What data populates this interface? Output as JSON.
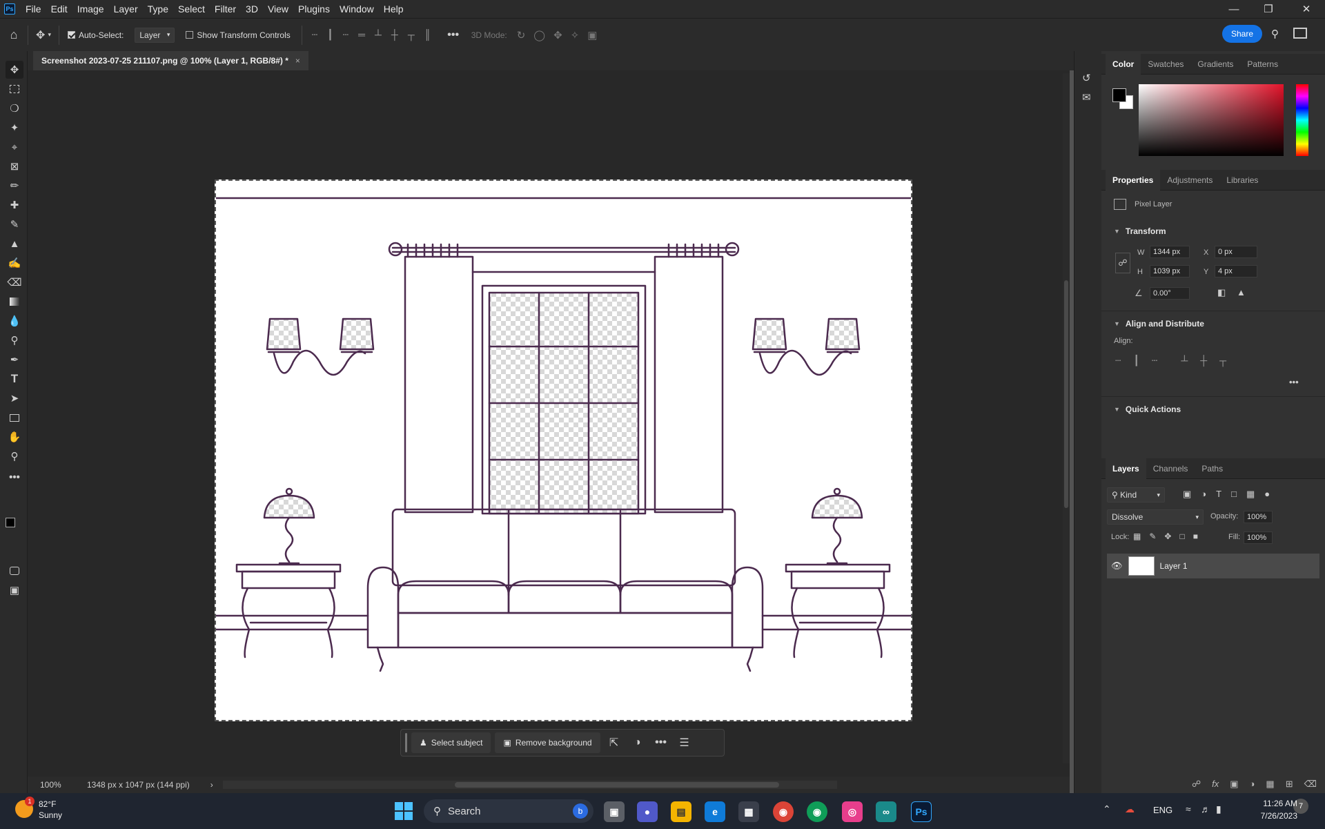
{
  "menubar": {
    "items": [
      "File",
      "Edit",
      "Image",
      "Layer",
      "Type",
      "Select",
      "Filter",
      "3D",
      "View",
      "Plugins",
      "Window",
      "Help"
    ],
    "logo": "Ps"
  },
  "options": {
    "auto_select_label": "Auto-Select:",
    "auto_select_value": "Layer",
    "show_transform_label": "Show Transform Controls",
    "mode_3d_label": "3D Mode:",
    "share_label": "Share"
  },
  "document": {
    "tab_title": "Screenshot 2023-07-25 211107.png @ 100% (Layer 1, RGB/8#) *",
    "close_glyph": "×"
  },
  "status": {
    "zoom": "100%",
    "dimensions": "1348 px x 1047 px (144 ppi)"
  },
  "context_bar": {
    "select_subject": "Select subject",
    "remove_background": "Remove background"
  },
  "color_panel": {
    "tabs": [
      "Color",
      "Swatches",
      "Gradients",
      "Patterns"
    ],
    "fg": "#000000",
    "bg": "#ffffff"
  },
  "properties_panel": {
    "tabs": [
      "Properties",
      "Adjustments",
      "Libraries"
    ],
    "layer_type": "Pixel Layer",
    "transform_title": "Transform",
    "w_label": "W",
    "w_value": "1344 px",
    "h_label": "H",
    "h_value": "1039 px",
    "x_label": "X",
    "x_value": "0 px",
    "y_label": "Y",
    "y_value": "4 px",
    "angle_value": "0.00°",
    "align_title": "Align and Distribute",
    "align_label": "Align:",
    "quick_actions_title": "Quick Actions"
  },
  "layers_panel": {
    "tabs": [
      "Layers",
      "Channels",
      "Paths"
    ],
    "kind_label": "Kind",
    "blend_mode": "Dissolve",
    "opacity_label": "Opacity:",
    "opacity_value": "100%",
    "lock_label": "Lock:",
    "fill_label": "Fill:",
    "fill_value": "100%",
    "layers": [
      {
        "name": "Layer 1"
      }
    ]
  },
  "taskbar": {
    "weather_temp": "82°F",
    "weather_desc": "Sunny",
    "weather_badge": "1",
    "search_label": "Search",
    "language": "ENG",
    "time": "11:26 AM",
    "date": "7/26/2023",
    "notification_count": "7"
  },
  "colors": {
    "accent": "#1473e6",
    "drawing_stroke": "#4b2a4e"
  }
}
